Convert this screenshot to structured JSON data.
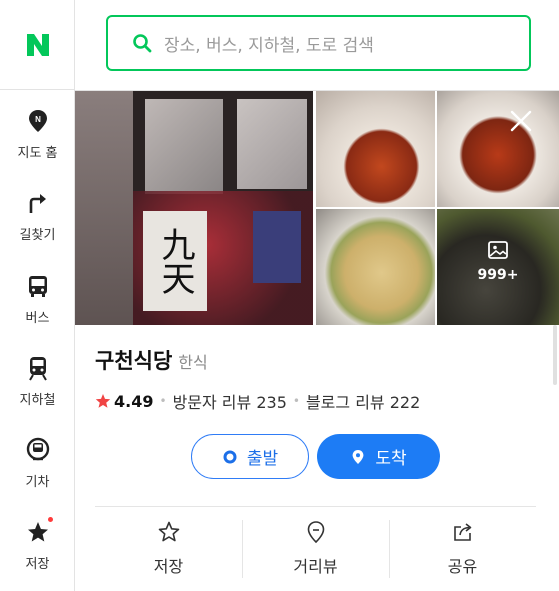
{
  "rail": {
    "items": [
      {
        "label": "지도 홈",
        "icon": "map-pin-icon"
      },
      {
        "label": "길찾기",
        "icon": "turn-arrow-icon"
      },
      {
        "label": "버스",
        "icon": "bus-icon"
      },
      {
        "label": "지하철",
        "icon": "subway-icon"
      },
      {
        "label": "기차",
        "icon": "train-icon"
      },
      {
        "label": "저장",
        "icon": "star-icon"
      }
    ]
  },
  "search": {
    "placeholder": "장소, 버스, 지하철, 도로 검색"
  },
  "photos": {
    "sign_text": "九天",
    "more_count": "999+"
  },
  "place": {
    "name": "구천식당",
    "category": "한식",
    "rating": "4.49",
    "visitor_reviews": "방문자 리뷰 235",
    "blog_reviews": "블로그 리뷰 222"
  },
  "buttons": {
    "start": "출발",
    "arrive": "도착"
  },
  "actions": {
    "save": "저장",
    "street_view": "거리뷰",
    "share": "공유"
  },
  "colors": {
    "brand": "#03c75a",
    "accent_blue": "#1d7cf5",
    "star": "#f04444"
  }
}
